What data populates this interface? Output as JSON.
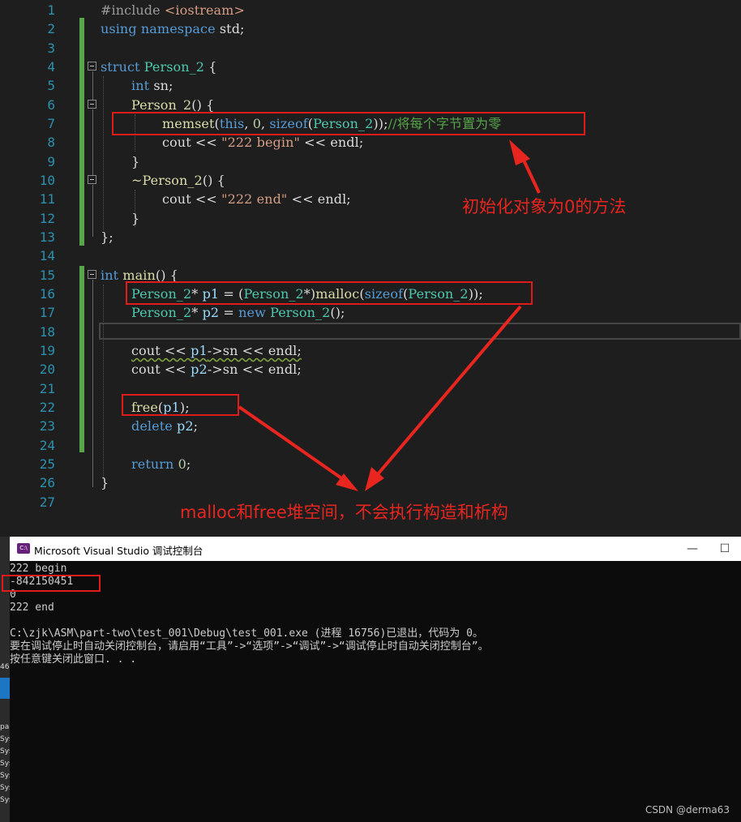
{
  "editor": {
    "line_numbers": [
      "1",
      "2",
      "3",
      "4",
      "5",
      "6",
      "7",
      "8",
      "9",
      "10",
      "11",
      "12",
      "13",
      "14",
      "15",
      "16",
      "17",
      "18",
      "19",
      "20",
      "21",
      "22",
      "23",
      "24",
      "25",
      "26",
      "27"
    ],
    "code": {
      "l1_a": "#include ",
      "l1_b": "<iostream>",
      "l2_a": "using",
      "l2_b": " namespace",
      "l2_c": " std;",
      "l4_a": "struct",
      "l4_b": " Person_2",
      "l4_c": " {",
      "l5_a": "int",
      "l5_b": " sn;",
      "l6_a": "Person_2",
      "l6_b": "() {",
      "l7_a": "memset",
      "l7_b": "(",
      "l7_c": "this",
      "l7_d": ", ",
      "l7_e": "0",
      "l7_f": ", ",
      "l7_g": "sizeof",
      "l7_h": "(",
      "l7_i": "Person_2",
      "l7_j": "));",
      "l7_k": "//将每个字节置为零",
      "l8_a": "cout << ",
      "l8_b": "\"222 begin\"",
      "l8_c": " << endl;",
      "l9": "}",
      "l10_a": "~Person_2",
      "l10_b": "() {",
      "l11_a": "cout << ",
      "l11_b": "\"222 end\"",
      "l11_c": " << endl;",
      "l12": "}",
      "l13": "};",
      "l15_a": "int",
      "l15_b": " main",
      "l15_c": "() {",
      "l16_a": "Person_2",
      "l16_b": "* ",
      "l16_c": "p1",
      "l16_d": " = (",
      "l16_e": "Person_2",
      "l16_f": "*)",
      "l16_g": "malloc",
      "l16_h": "(",
      "l16_i": "sizeof",
      "l16_j": "(",
      "l16_k": "Person_2",
      "l16_l": "));",
      "l17_a": "Person_2",
      "l17_b": "* ",
      "l17_c": "p2",
      "l17_d": " = ",
      "l17_e": "new",
      "l17_f": " Person_2",
      "l17_g": "();",
      "l19_a": "cout << ",
      "l19_b": "p1",
      "l19_c": "->sn << endl;",
      "l20_a": "cout << ",
      "l20_b": "p2",
      "l20_c": "->sn << endl;",
      "l22_a": "free",
      "l22_b": "(",
      "l22_c": "p1",
      "l22_d": ");",
      "l23_a": "delete",
      "l23_b": " p2",
      "l23_c": ";",
      "l25_a": "return",
      "l25_b": " 0",
      "l25_c": ";",
      "l26": "}"
    },
    "annotations": {
      "init_zero": "初始化对象为0的方法",
      "malloc_free": "malloc和free堆空间，不会执行构造和析构"
    }
  },
  "console": {
    "title": "Microsoft Visual Studio 调试控制台",
    "icon_text": "C:\\",
    "minimize": "—",
    "maximize": "☐",
    "output": [
      "222 begin",
      "-842150451",
      "0",
      "222 end",
      "",
      "C:\\zjk\\ASM\\part-two\\test_001\\Debug\\test_001.exe (进程 16756)已退出，代码为 0。",
      "要在调试停止时自动关闭控制台，请启用“工具”->“选项”->“调试”->“调试停止时自动关闭控制台”。",
      "按任意键关闭此窗口. . ."
    ]
  },
  "left_strip": [
    "46",
    "pa",
    "Sys",
    "Sys",
    "Sys",
    "Sys",
    "Sys",
    "Sys"
  ],
  "watermark": "CSDN @derma63",
  "colors": {
    "annotation_red": "#e01b1b",
    "keyword_blue": "#569cd6",
    "type_teal": "#4ec9b0",
    "comment_green": "#57a64a",
    "string": "#d69d85",
    "editor_bg": "#1e1e1e",
    "console_bg": "#0c0c0c"
  },
  "icons": [
    "fold-minus-icon",
    "console-app-icon",
    "arrow-icon"
  ]
}
